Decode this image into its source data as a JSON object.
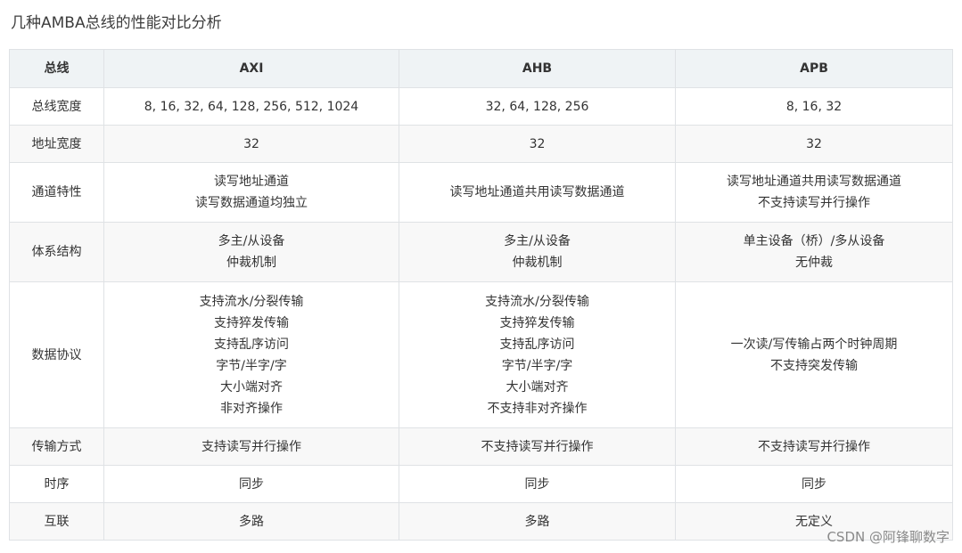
{
  "title": "几种AMBA总线的性能对比分析",
  "table": {
    "headers": [
      "总线",
      "AXI",
      "AHB",
      "APB"
    ],
    "rows": [
      {
        "label": "总线宽度",
        "cells": [
          [
            "8, 16, 32, 64, 128, 256, 512, 1024"
          ],
          [
            "32, 64, 128, 256"
          ],
          [
            "8, 16, 32"
          ]
        ]
      },
      {
        "label": "地址宽度",
        "cells": [
          [
            "32"
          ],
          [
            "32"
          ],
          [
            "32"
          ]
        ]
      },
      {
        "label": "通道特性",
        "cells": [
          [
            "读写地址通道",
            "读写数据通道均独立"
          ],
          [
            "读写地址通道共用读写数据通道"
          ],
          [
            "读写地址通道共用读写数据通道",
            "不支持读写并行操作"
          ]
        ]
      },
      {
        "label": "体系结构",
        "cells": [
          [
            "多主/从设备",
            "仲裁机制"
          ],
          [
            "多主/从设备",
            "仲裁机制"
          ],
          [
            "单主设备（桥）/多从设备",
            "无仲裁"
          ]
        ]
      },
      {
        "label": "数据协议",
        "cells": [
          [
            "支持流水/分裂传输",
            "支持猝发传输",
            "支持乱序访问",
            "字节/半字/字",
            "大小端对齐",
            "非对齐操作"
          ],
          [
            "支持流水/分裂传输",
            "支持猝发传输",
            "支持乱序访问",
            "字节/半字/字",
            "大小端对齐",
            "不支持非对齐操作"
          ],
          [
            "一次读/写传输占两个时钟周期",
            "不支持突发传输"
          ]
        ]
      },
      {
        "label": "传输方式",
        "cells": [
          [
            "支持读写并行操作"
          ],
          [
            "不支持读写并行操作"
          ],
          [
            "不支持读写并行操作"
          ]
        ]
      },
      {
        "label": "时序",
        "cells": [
          [
            "同步"
          ],
          [
            "同步"
          ],
          [
            "同步"
          ]
        ]
      },
      {
        "label": "互联",
        "cells": [
          [
            "多路"
          ],
          [
            "多路"
          ],
          [
            "无定义"
          ]
        ]
      }
    ]
  },
  "watermark": "CSDN @阿锋聊数字"
}
